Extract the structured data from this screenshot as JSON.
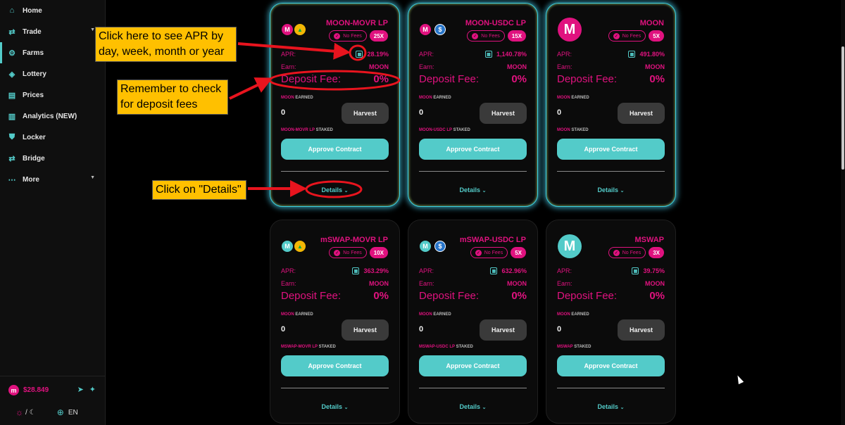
{
  "sidebar": {
    "items": [
      {
        "label": "Home",
        "icon": "home-icon",
        "glyph": "⌂"
      },
      {
        "label": "Trade",
        "icon": "swap-icon",
        "glyph": "⇄"
      },
      {
        "label": "Farms",
        "icon": "tractor-icon",
        "glyph": "⚙"
      },
      {
        "label": "Lottery",
        "icon": "ticket-icon",
        "glyph": "◈"
      },
      {
        "label": "Prices",
        "icon": "chart-icon",
        "glyph": "▤"
      },
      {
        "label": "Analytics (NEW)",
        "icon": "analytics-icon",
        "glyph": "▥"
      },
      {
        "label": "Locker",
        "icon": "shield-icon",
        "glyph": "⛊"
      },
      {
        "label": "Bridge",
        "icon": "bridge-icon",
        "glyph": "⇄"
      },
      {
        "label": "More",
        "icon": "more-icon",
        "glyph": "⋯"
      }
    ],
    "price": "$28.849",
    "language": "EN",
    "theme_separator": "/"
  },
  "farms": [
    {
      "title": "MOON-MOVR LP",
      "multiplier": "25X",
      "apr": "28.19%",
      "earn": "MOON",
      "fee": "0%",
      "earned_token": "MOON",
      "earned": "0",
      "staked_token": "MOON-MOVR LP",
      "logos": [
        "M",
        "▲"
      ]
    },
    {
      "title": "MOON-USDC LP",
      "multiplier": "15X",
      "apr": "1,140.78%",
      "earn": "MOON",
      "fee": "0%",
      "earned_token": "MOON",
      "earned": "0",
      "staked_token": "MOON-USDC LP",
      "logos": [
        "M",
        "$"
      ]
    },
    {
      "title": "MOON",
      "multiplier": "5X",
      "apr": "491.80%",
      "earn": "MOON",
      "fee": "0%",
      "earned_token": "MOON",
      "earned": "0",
      "staked_token": "MOON",
      "logos": [
        "M"
      ]
    },
    {
      "title": "mSWAP-MOVR LP",
      "multiplier": "10X",
      "apr": "363.29%",
      "earn": "MOON",
      "fee": "0%",
      "earned_token": "MOON",
      "earned": "0",
      "staked_token": "MSWAP-MOVR LP",
      "logos": [
        "M",
        "▲"
      ]
    },
    {
      "title": "mSWAP-USDC LP",
      "multiplier": "5X",
      "apr": "632.96%",
      "earn": "MOON",
      "fee": "0%",
      "earned_token": "MOON",
      "earned": "0",
      "staked_token": "MSWAP-USDC LP",
      "logos": [
        "M",
        "$"
      ]
    },
    {
      "title": "MSWAP",
      "multiplier": "3X",
      "apr": "39.75%",
      "earn": "MOON",
      "fee": "0%",
      "earned_token": "MOON",
      "earned": "0",
      "staked_token": "MSWAP",
      "logos": [
        "M"
      ]
    }
  ],
  "labels": {
    "no_fees": "No Fees",
    "apr": "APR:",
    "earn": "Earn:",
    "deposit_fee": "Deposit Fee:",
    "earned_suffix": "EARNED",
    "staked_suffix": "STAKED",
    "harvest": "Harvest",
    "approve": "Approve Contract",
    "details": "Details"
  },
  "annotations": {
    "apr_note_line1": "Click here to see APR by",
    "apr_note_line2": "day, week, month or year",
    "fee_note_line1": "Remember to check",
    "fee_note_line2": "for deposit fees",
    "details_note": "Click on \"Details\""
  },
  "colors": {
    "accent_pink": "#e0127f",
    "accent_teal": "#53cbc9",
    "callout": "#ffc000",
    "arrow_red": "#e8141e"
  }
}
